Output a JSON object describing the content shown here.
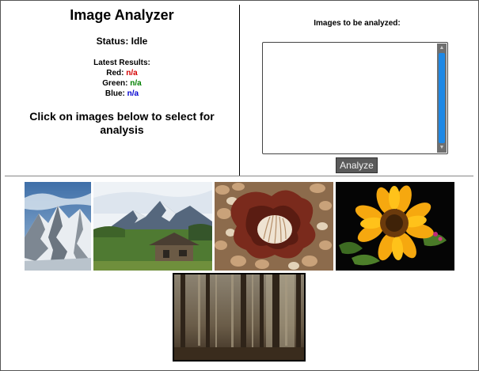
{
  "app": {
    "title": "Image Analyzer",
    "status": "Status: Idle",
    "results_heading": "Latest Results:",
    "red_label": "Red:",
    "red_value": "n/a",
    "green_label": "Green:",
    "green_value": "n/a",
    "blue_label": "Blue:",
    "blue_value": "n/a",
    "instructions": "Click on images below to select for analysis"
  },
  "queue": {
    "label": "Images to be analyzed:",
    "items": []
  },
  "actions": {
    "analyze_label": "Analyze"
  },
  "gallery": [
    {
      "name": "mountain-snow-image",
      "subject": "snowy mountain peaks"
    },
    {
      "name": "alpine-cabin-image",
      "subject": "mountains with wooden cabin in meadow"
    },
    {
      "name": "seashell-image",
      "subject": "seashell on pebbles"
    },
    {
      "name": "sunflower-image",
      "subject": "sunflower on black background"
    },
    {
      "name": "foggy-forest-image",
      "subject": "misty forest with tall trees"
    }
  ],
  "colors": {
    "red_value": "#d40000",
    "green_value": "#008000",
    "blue_value": "#0000d0",
    "scroll_thumb": "#1e88e5",
    "button_bg": "#5a5a5a"
  }
}
